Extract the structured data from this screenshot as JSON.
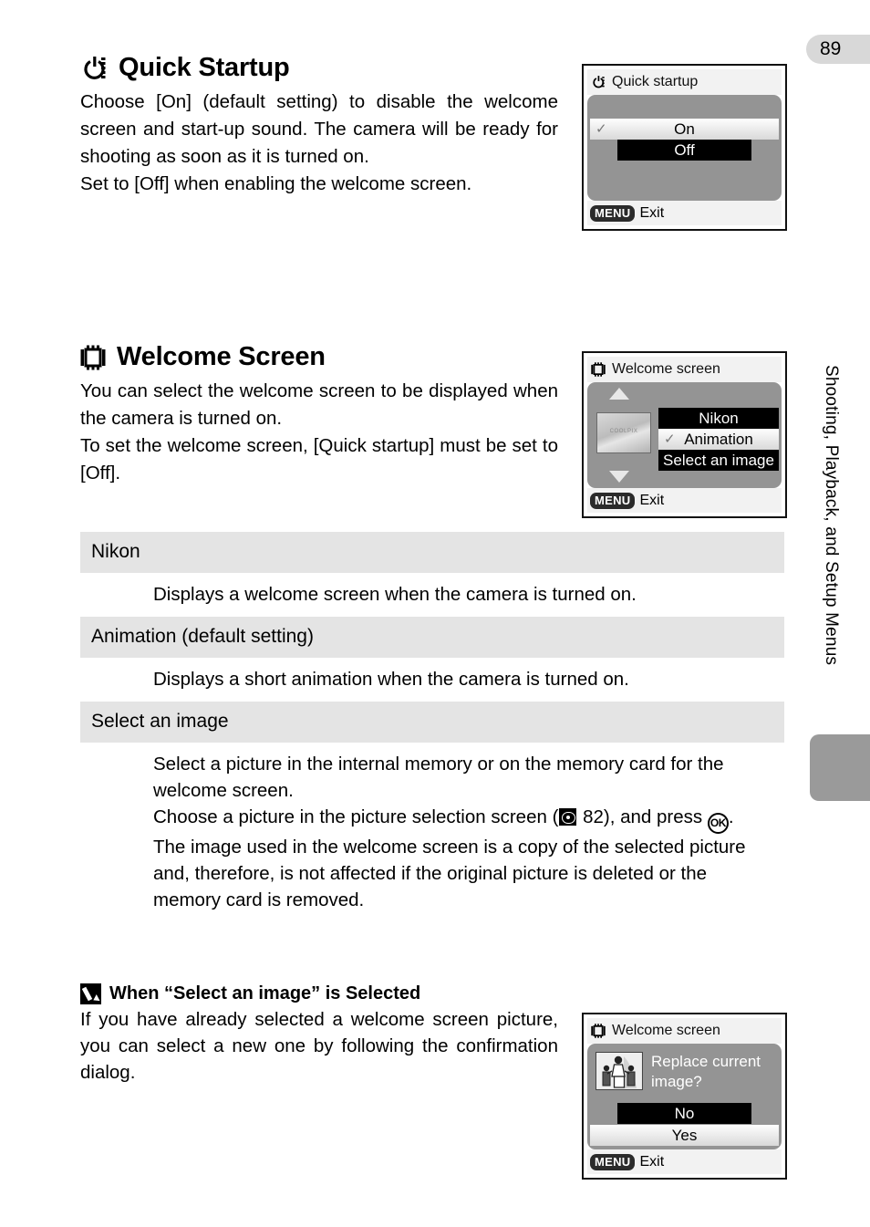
{
  "page": {
    "number": "89",
    "side_tab_label": "Shooting, Playback, and Setup Menus"
  },
  "sections": [
    {
      "id": "quick-startup",
      "icon": "power-icon",
      "title": "Quick Startup",
      "paragraphs": [
        "Choose [On] (default setting) to disable the welcome screen and start-up sound. The camera will be ready for shooting as soon as it is turned on.",
        "Set to [Off] when enabling the welcome screen."
      ]
    },
    {
      "id": "welcome-screen",
      "icon": "screen-frame-icon",
      "title": "Welcome Screen",
      "paragraphs": [
        "You can select the welcome screen to be displayed when the camera is turned on.",
        "To set the welcome screen, [Quick startup] must be set to [Off]."
      ]
    }
  ],
  "options_table": [
    {
      "name": "Nikon",
      "description": "Displays a welcome screen when the camera is turned on."
    },
    {
      "name": "Animation (default setting)",
      "description": "Displays a short animation when the camera is turned on."
    },
    {
      "name": "Select an image",
      "description_parts": {
        "line1": "Select a picture in the internal memory or on the memory card for the welcome screen.",
        "line2_before": "Choose a picture in the picture selection screen (",
        "line2_page": " 82), and press ",
        "ok_glyph": "OK",
        "line2_after": ".",
        "line3": "The image used in the welcome screen is a copy of the selected picture and, therefore, is not affected if the original picture is deleted or the memory card is removed."
      }
    }
  ],
  "note": {
    "icon": "pencil-icon",
    "title": "When “Select an image” is Selected",
    "text": "If you have already selected a welcome screen picture, you can select a new one by following the confirmation dialog."
  },
  "lcd_screens": [
    {
      "id": "quick-startup-menu",
      "icon": "power-icon",
      "title": "Quick startup",
      "options": [
        {
          "label": "On",
          "selected": true,
          "checked": true
        },
        {
          "label": "Off",
          "selected": false,
          "checked": false
        }
      ],
      "footer_badge": "MENU",
      "footer_label": "Exit"
    },
    {
      "id": "welcome-screen-menu",
      "icon": "screen-frame-icon",
      "title": "Welcome screen",
      "thumbnail_label": "COOLPIX",
      "options": [
        {
          "label": "Nikon",
          "selected": false,
          "checked": false
        },
        {
          "label": "Animation",
          "selected": true,
          "checked": true
        },
        {
          "label": "Select an image",
          "selected": false,
          "checked": false
        }
      ],
      "footer_badge": "MENU",
      "footer_label": "Exit"
    },
    {
      "id": "replace-image-dialog",
      "icon": "screen-frame-icon",
      "title": "Welcome screen",
      "prompt": "Replace current image?",
      "options": [
        {
          "label": "No",
          "selected": false,
          "checked": false
        },
        {
          "label": "Yes",
          "selected": true,
          "checked": false
        }
      ],
      "footer_badge": "MENU",
      "footer_label": "Exit"
    }
  ],
  "colors": {
    "table_header_bg": "#e4e4e4",
    "lcd_screen_bg": "#949494",
    "side_tab": "#9a9a9a",
    "page_tab": "#d8d8d8"
  }
}
